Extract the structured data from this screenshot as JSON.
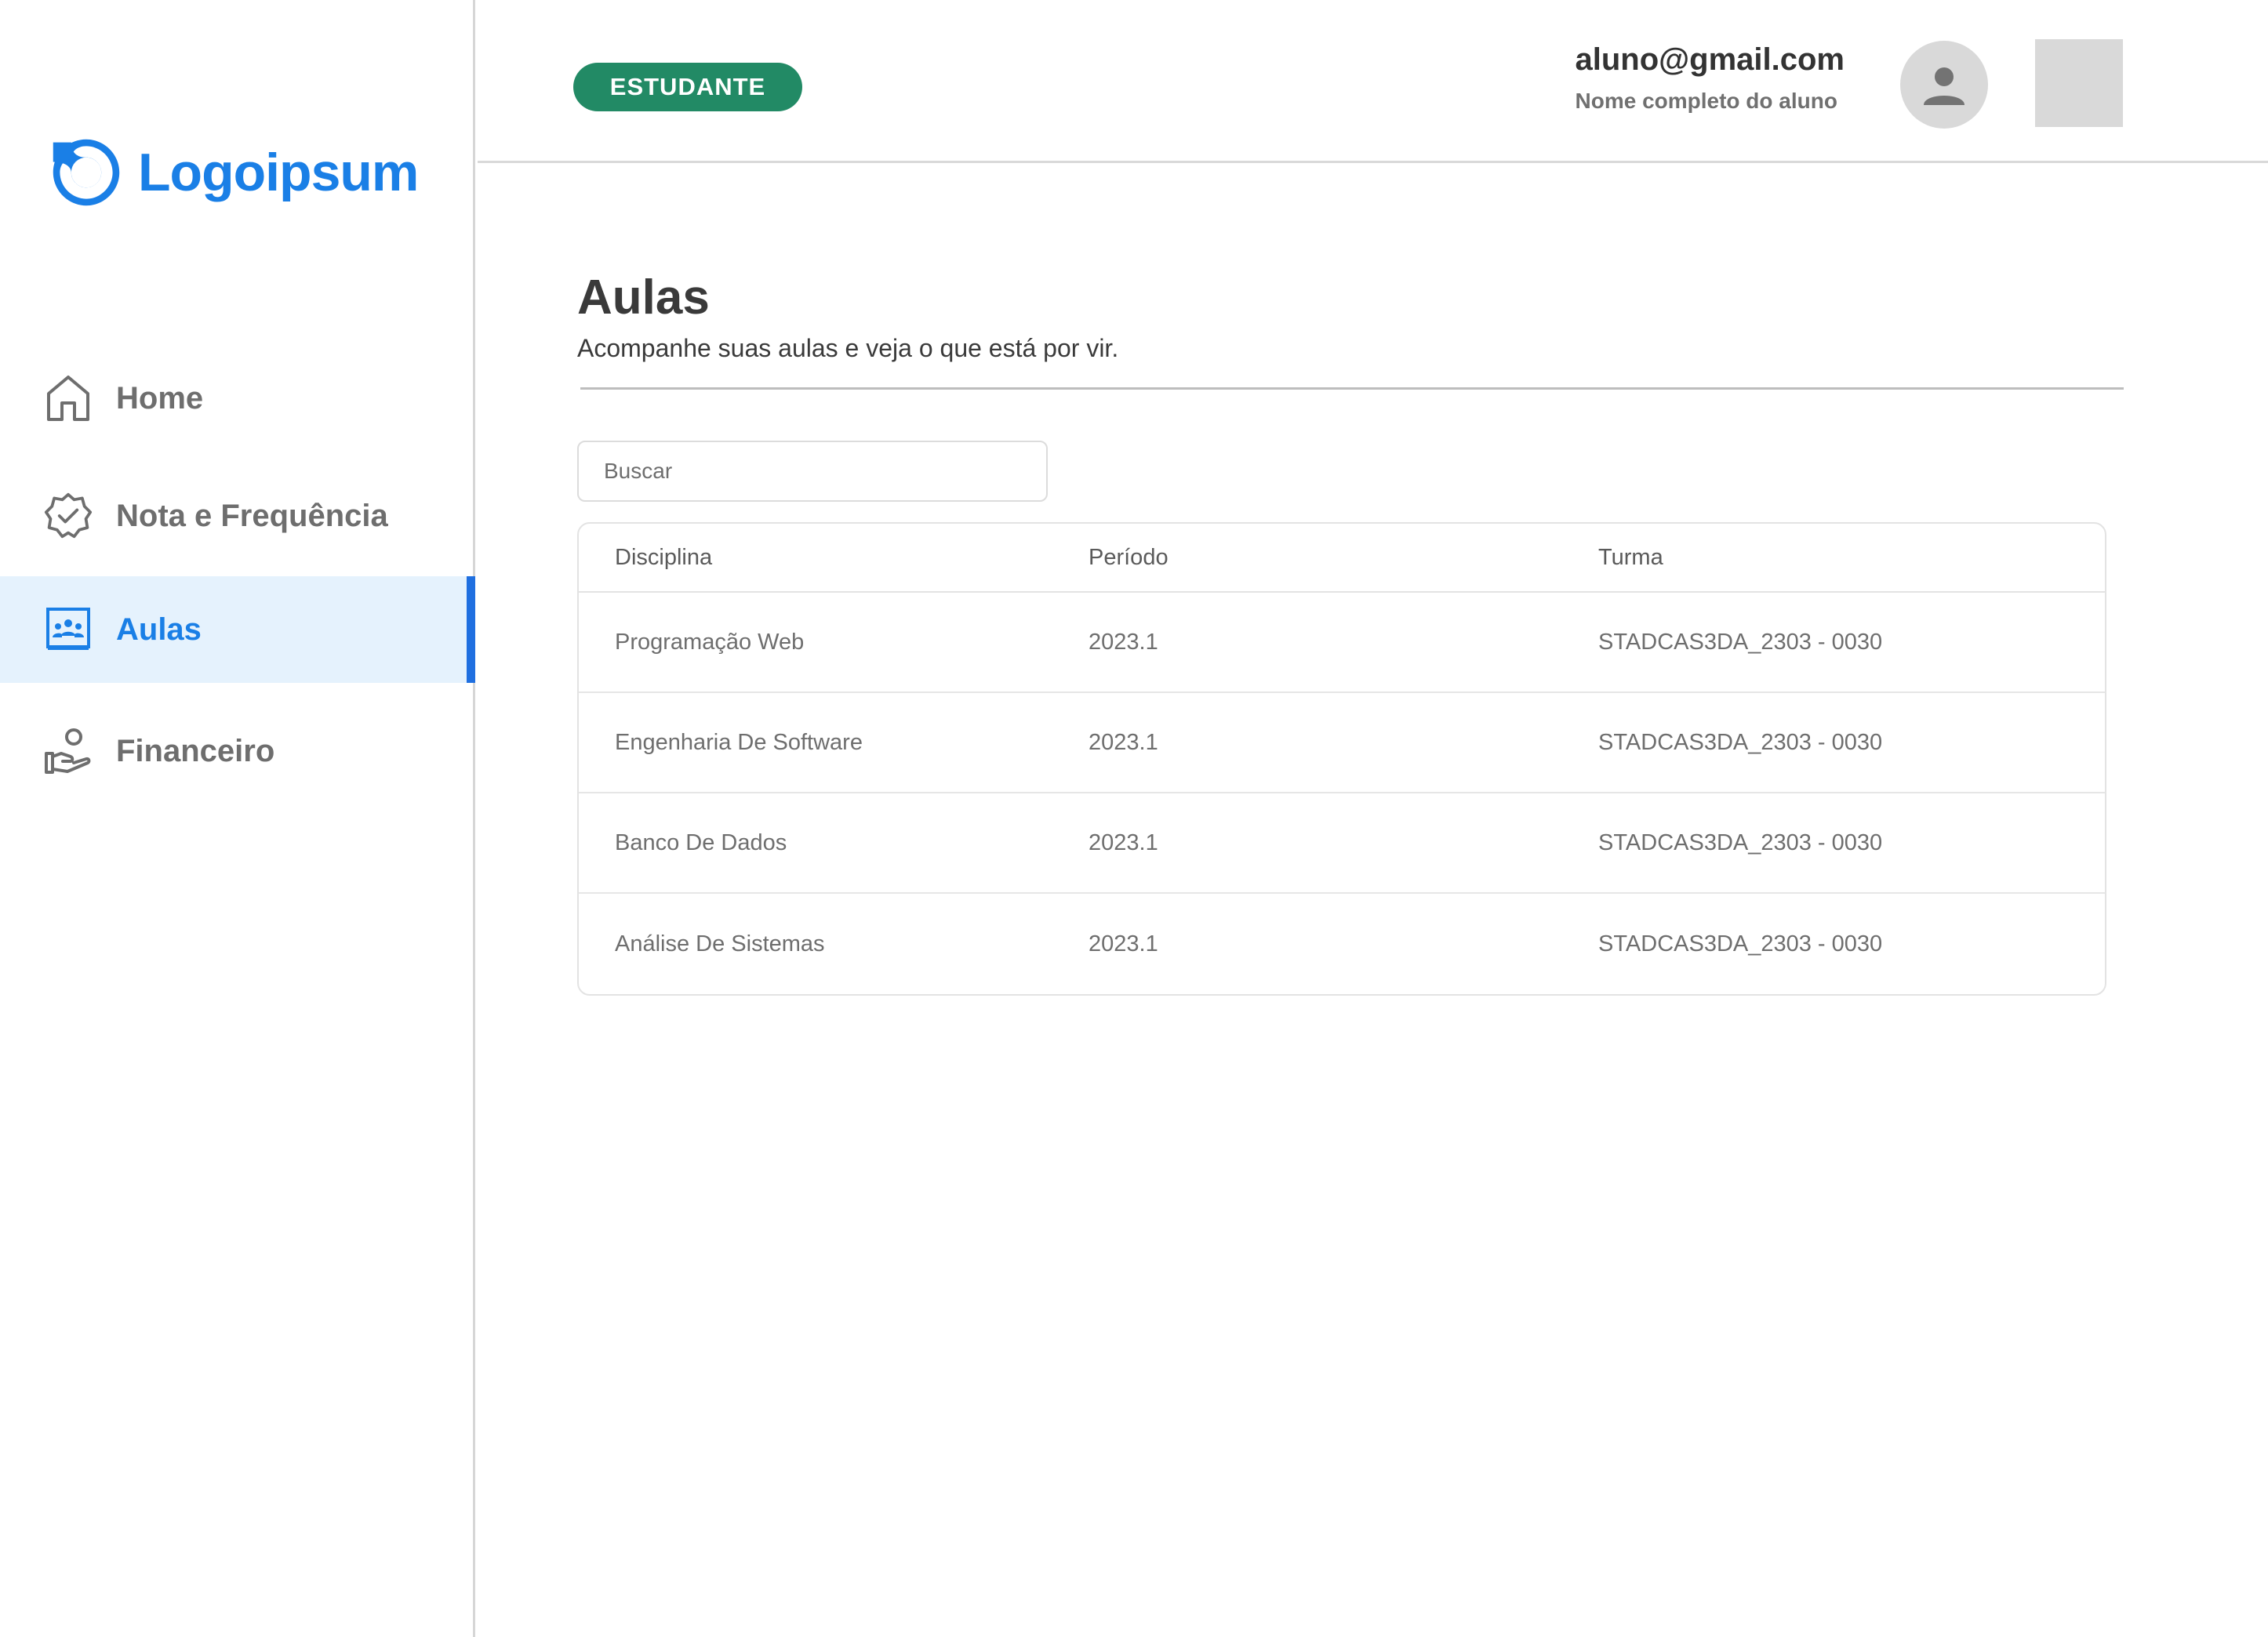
{
  "logo": {
    "text": "Logoipsum"
  },
  "sidebar": {
    "items": [
      {
        "label": "Home",
        "icon": "home-icon",
        "active": false
      },
      {
        "label": "Nota e Frequência",
        "icon": "verified-badge-icon",
        "active": false
      },
      {
        "label": "Aulas",
        "icon": "classroom-icon",
        "active": true
      },
      {
        "label": "Financeiro",
        "icon": "hand-payment-icon",
        "active": false
      }
    ]
  },
  "header": {
    "role_badge": "ESTUDANTE",
    "user_email": "aluno@gmail.com",
    "user_name": "Nome completo do  aluno",
    "avatar_icon": "user-icon"
  },
  "main": {
    "title": "Aulas",
    "subtitle": "Acompanhe suas aulas e veja o que está por vir.",
    "search": {
      "placeholder": "Buscar",
      "value": ""
    },
    "table": {
      "columns": [
        "Disciplina",
        "Período",
        "Turma"
      ],
      "rows": [
        [
          "Programação Web",
          "2023.1",
          "STADCAS3DA_2303 - 0030"
        ],
        [
          "Engenharia De Software",
          "2023.1",
          "STADCAS3DA_2303 - 0030"
        ],
        [
          "Banco De Dados",
          "2023.1",
          "STADCAS3DA_2303 - 0030"
        ],
        [
          "Análise De Sistemas",
          "2023.1",
          "STADCAS3DA_2303 - 0030"
        ]
      ]
    }
  },
  "colors": {
    "brand": "#1a7fe6",
    "active_indicator": "#1f6fe0",
    "active_bg": "#e5f2fd",
    "badge": "#228a65"
  }
}
